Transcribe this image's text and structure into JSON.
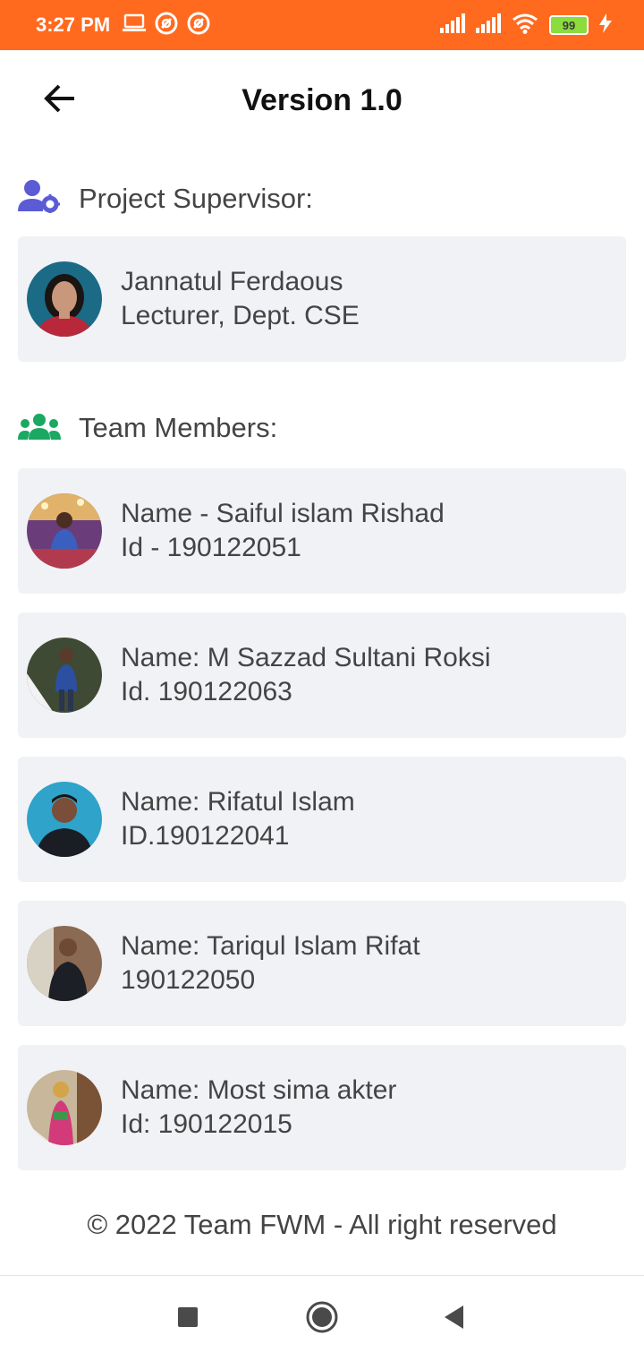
{
  "status_bar": {
    "time": "3:27 PM",
    "battery_level": "99",
    "icons": [
      "laptop-icon",
      "at-sign-icon",
      "at-sign-icon",
      "signal-icon",
      "signal-icon",
      "wifi-icon",
      "battery-icon",
      "charging-icon"
    ],
    "background": "#ff6a1f"
  },
  "app_bar": {
    "title": "Version 1.0",
    "back_icon": "arrow-back-icon"
  },
  "supervisor_section": {
    "heading": "Project Supervisor:",
    "icon": "user-cog-icon",
    "icon_color": "#5b5bd6",
    "card": {
      "line1": "Jannatul Ferdaous",
      "line2": "Lecturer, Dept. CSE"
    }
  },
  "team_section": {
    "heading": "Team Members:",
    "icon": "users-icon",
    "icon_color": "#1ba862",
    "members": [
      {
        "line1": "Name - Saiful islam Rishad",
        "line2": "Id - 190122051"
      },
      {
        "line1": "Name: M Sazzad Sultani Roksi",
        "line2": "Id. 190122063"
      },
      {
        "line1": "Name: Rifatul  Islam",
        "line2": "ID.190122041"
      },
      {
        "line1": "Name: Tariqul Islam Rifat",
        "line2": "190122050"
      },
      {
        "line1": "Name: Most sima akter",
        "line2": "Id: 190122015"
      }
    ]
  },
  "footer": {
    "text": "© 2022 Team FWM - All right reserved"
  },
  "nav_bar": {
    "buttons": [
      "recents-square-icon",
      "home-circle-icon",
      "back-triangle-icon"
    ]
  },
  "colors": {
    "card_background": "#f1f2f6",
    "text": "#444444"
  }
}
